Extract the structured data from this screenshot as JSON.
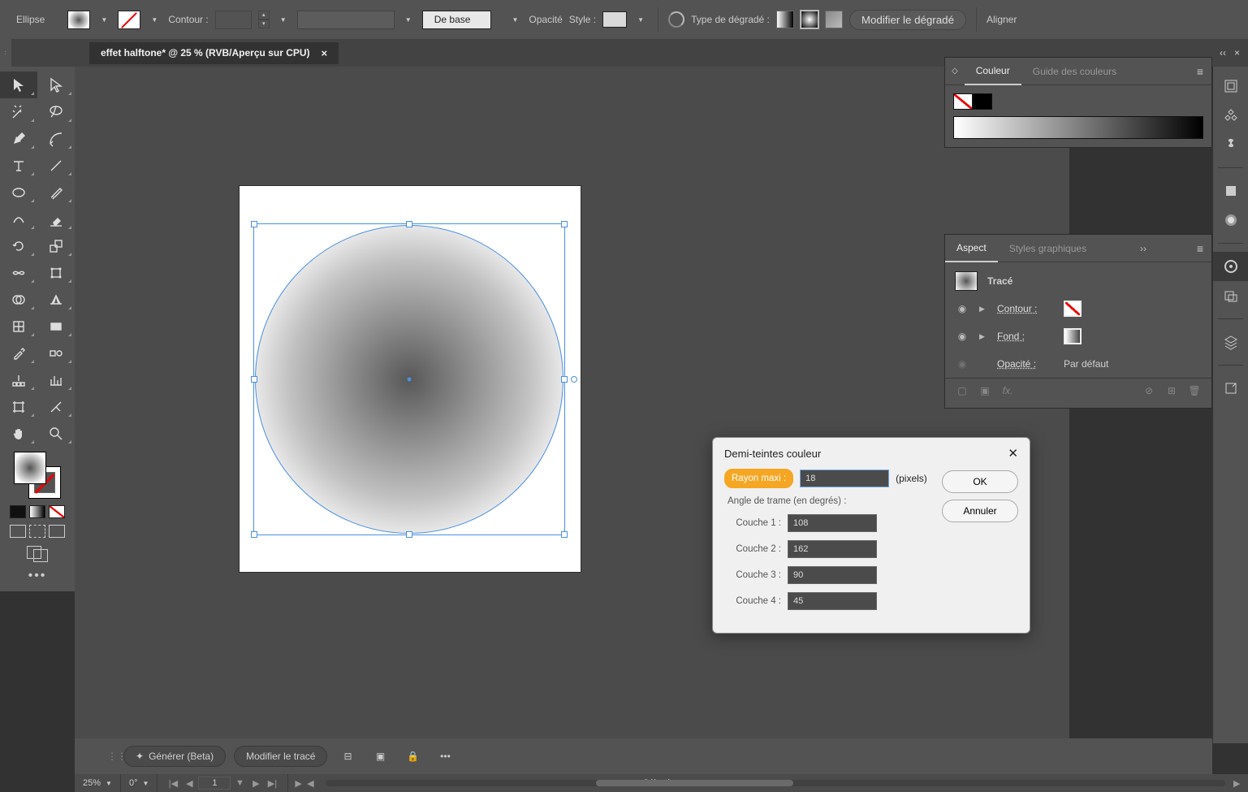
{
  "topbar": {
    "shape": "Ellipse",
    "contour_label": "Contour :",
    "stroke_style": "De base",
    "opacity_label": "Opacité",
    "style_label": "Style :",
    "grad_type_label": "Type de dégradé :",
    "edit_grad": "Modifier le dégradé",
    "align": "Aligner"
  },
  "doc": {
    "tab_title": "effet halftone* @ 25 % (RVB/Aperçu sur CPU)",
    "close": "×"
  },
  "tools": {
    "names": [
      [
        "selection",
        "direct-selection"
      ],
      [
        "magic-wand",
        "lasso"
      ],
      [
        "pen",
        "curvature"
      ],
      [
        "type",
        "line-segment"
      ],
      [
        "ellipse",
        "paintbrush"
      ],
      [
        "shaper",
        "eraser"
      ],
      [
        "rotate",
        "scale"
      ],
      [
        "width",
        "free-transform"
      ],
      [
        "shape-builder",
        "perspective-grid"
      ],
      [
        "mesh",
        "gradient"
      ],
      [
        "eyedropper",
        "blend"
      ],
      [
        "symbol-sprayer",
        "column-graph"
      ],
      [
        "artboard",
        "slice"
      ],
      [
        "hand",
        "zoom"
      ]
    ]
  },
  "color_panel": {
    "tab1": "Couleur",
    "tab2": "Guide des couleurs"
  },
  "aspect_panel": {
    "tab1": "Aspect",
    "tab2": "Styles graphiques",
    "more": "››",
    "path_label": "Tracé",
    "stroke_label": "Contour :",
    "fill_label": "Fond :",
    "opacity_label": "Opacité :",
    "opacity_val": "Par défaut",
    "fx_label": "fx."
  },
  "dialog": {
    "title": "Demi-teintes couleur",
    "max_radius_label": "Rayon maxi :",
    "max_radius_value": "18",
    "pixels": "(pixels)",
    "angle_title": "Angle de trame (en degrés) :",
    "ch1_label": "Couche 1 :",
    "ch1_val": "108",
    "ch2_label": "Couche 2 :",
    "ch2_val": "162",
    "ch3_label": "Couche 3 :",
    "ch3_val": "90",
    "ch4_label": "Couche 4 :",
    "ch4_val": "45",
    "ok": "OK",
    "cancel": "Annuler"
  },
  "taskbar": {
    "generate": "Générer (Beta)",
    "edit_path": "Modifier le tracé"
  },
  "status": {
    "zoom": "25%",
    "angle": "0°",
    "page": "1",
    "mode": "Sélection"
  }
}
